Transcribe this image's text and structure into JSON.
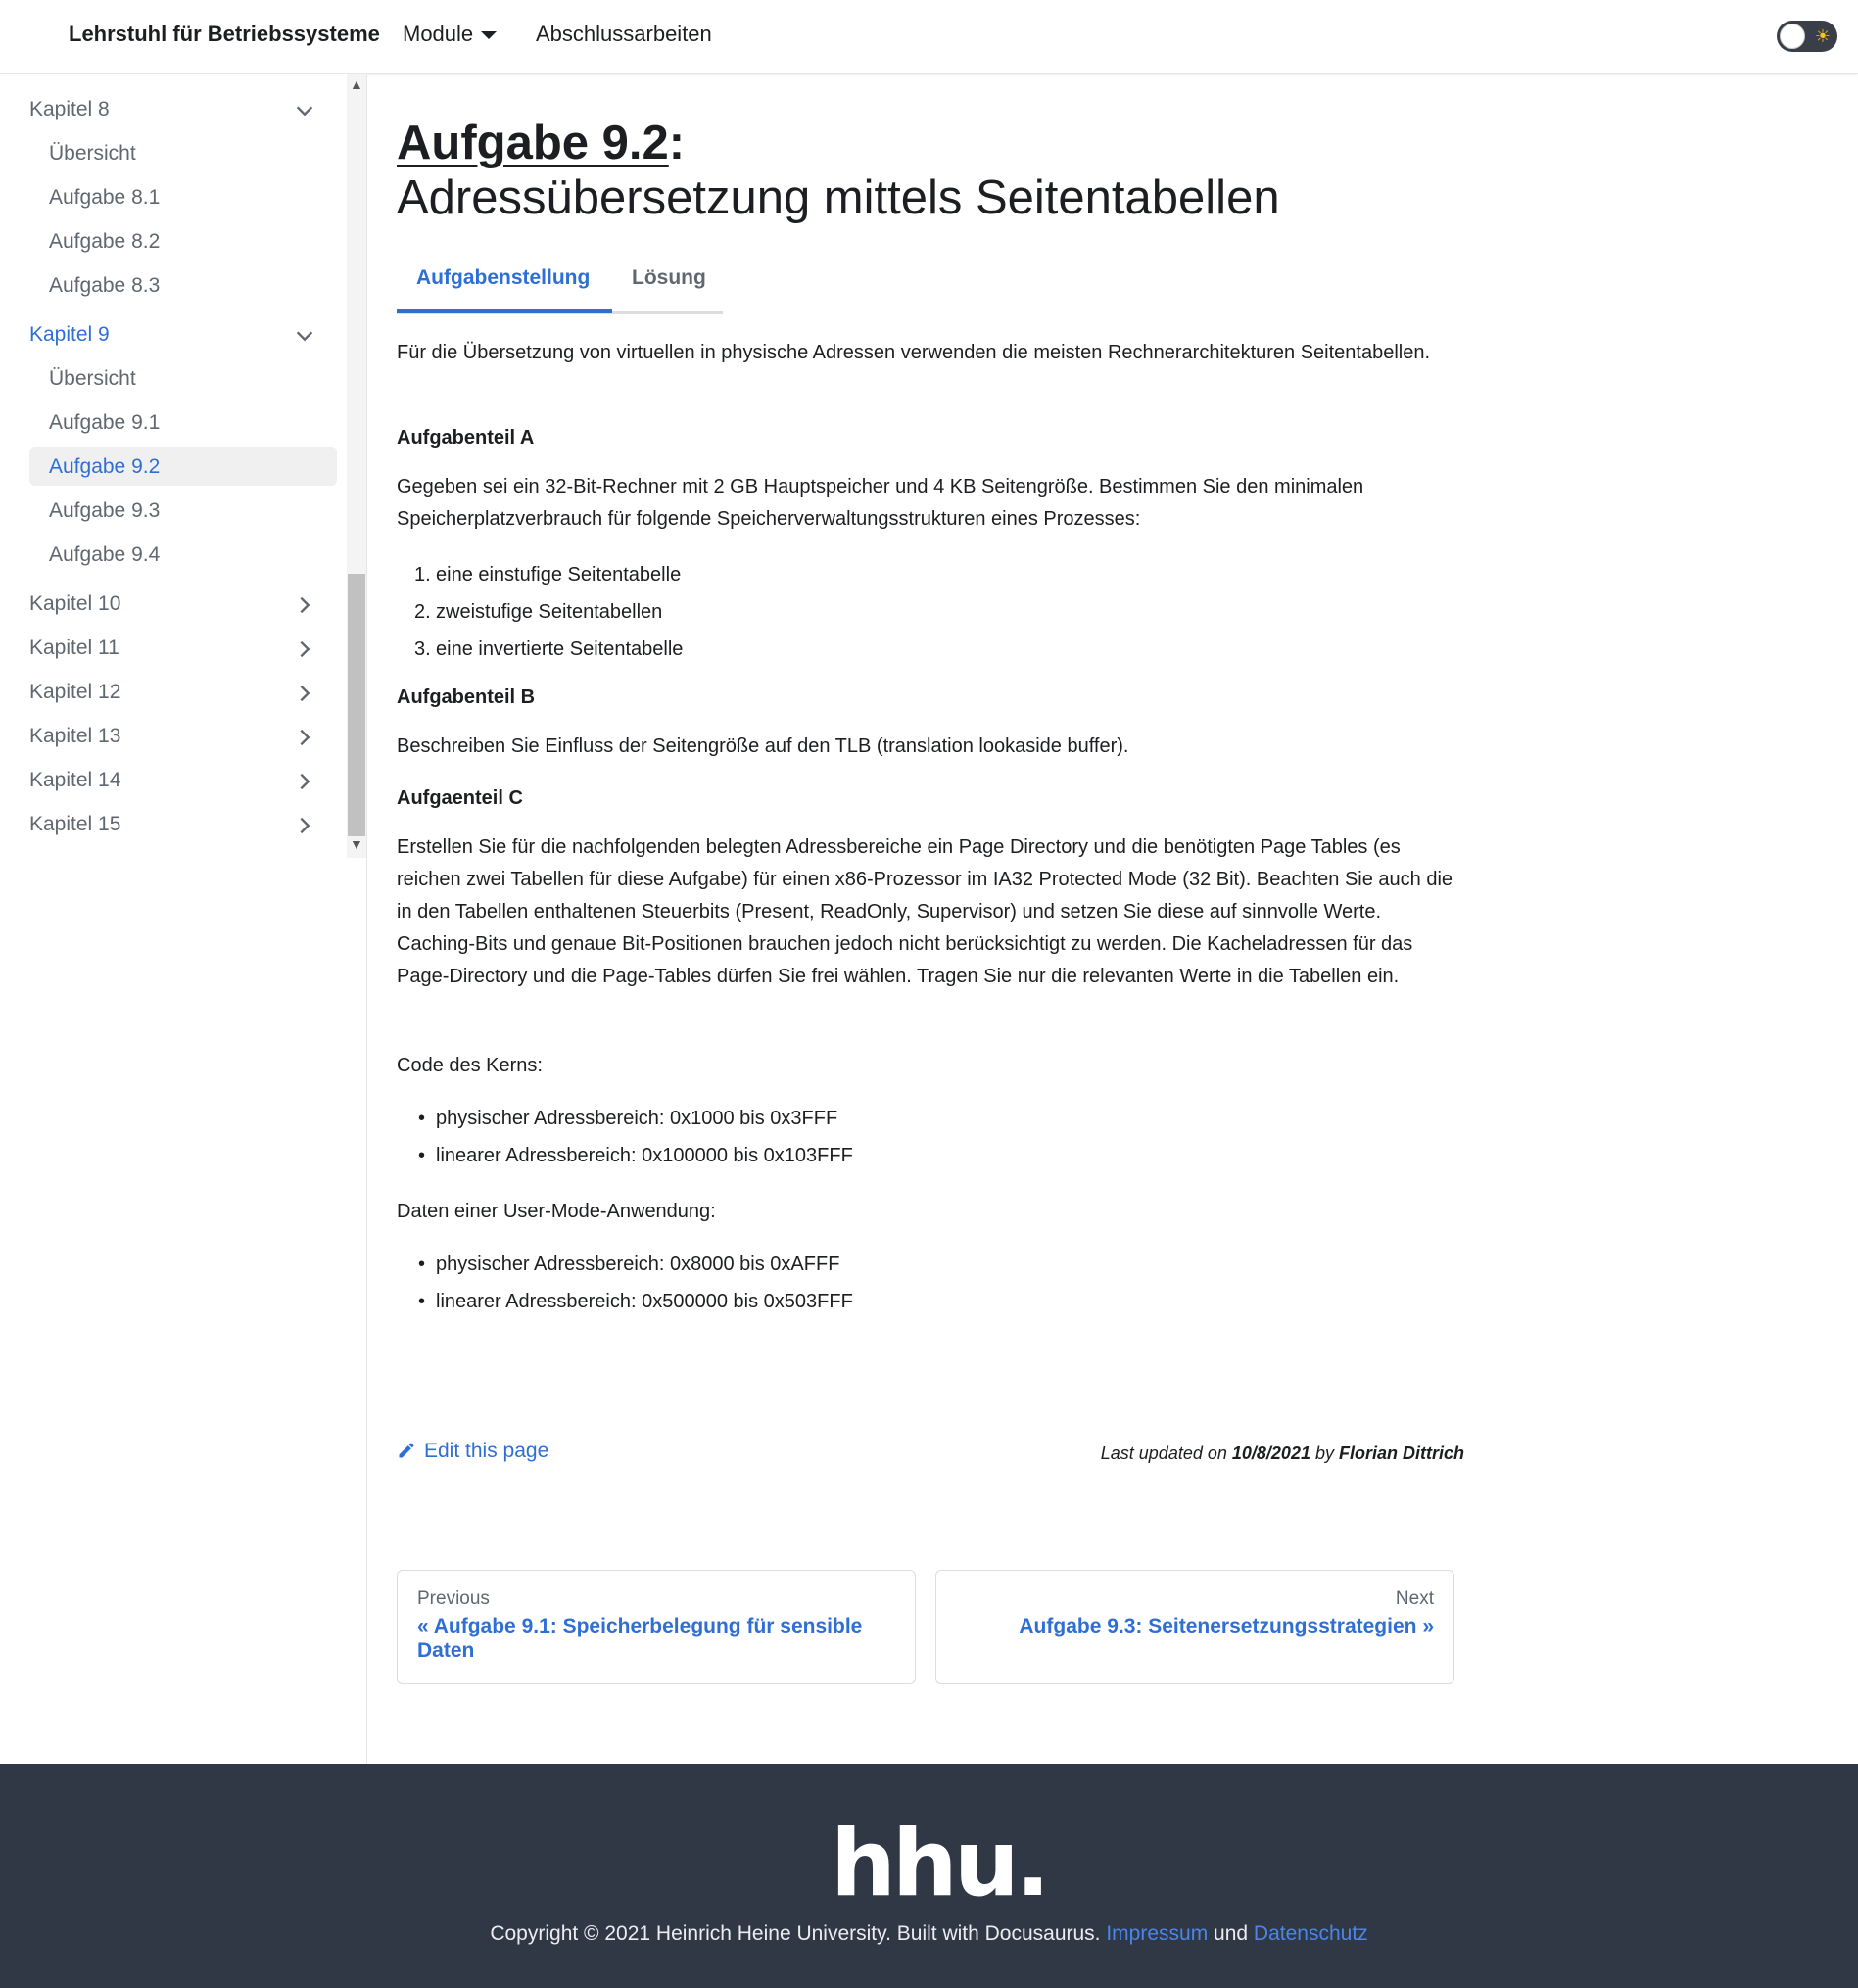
{
  "navbar": {
    "brand": "Lehrstuhl für Betriebssysteme",
    "items": [
      {
        "label": "Module"
      },
      {
        "label": "Abschlussarbeiten"
      }
    ],
    "toggle_icon": "sun-icon"
  },
  "sidebar": {
    "items": [
      {
        "label": "Kapitel 8",
        "type": "category",
        "expanded": true
      },
      {
        "label": "Übersicht",
        "type": "link"
      },
      {
        "label": "Aufgabe 8.1",
        "type": "link"
      },
      {
        "label": "Aufgabe 8.2",
        "type": "link"
      },
      {
        "label": "Aufgabe 8.3",
        "type": "link"
      },
      {
        "label": "Kapitel 9",
        "type": "category",
        "expanded": true,
        "active": true
      },
      {
        "label": "Übersicht",
        "type": "link"
      },
      {
        "label": "Aufgabe 9.1",
        "type": "link"
      },
      {
        "label": "Aufgabe 9.2",
        "type": "link",
        "active": true
      },
      {
        "label": "Aufgabe 9.3",
        "type": "link"
      },
      {
        "label": "Aufgabe 9.4",
        "type": "link"
      },
      {
        "label": "Kapitel 10",
        "type": "category",
        "expanded": false
      },
      {
        "label": "Kapitel 11",
        "type": "category",
        "expanded": false
      },
      {
        "label": "Kapitel 12",
        "type": "category",
        "expanded": false
      },
      {
        "label": "Kapitel 13",
        "type": "category",
        "expanded": false
      },
      {
        "label": "Kapitel 14",
        "type": "category",
        "expanded": false
      },
      {
        "label": "Kapitel 15",
        "type": "category",
        "expanded": false
      }
    ]
  },
  "main": {
    "title_link": "Aufgabe 9.2",
    "title_colon": ":",
    "subtitle": "Adressübersetzung mittels Seitentabellen",
    "tabs": [
      {
        "label": "Aufgabenstellung",
        "active": true
      },
      {
        "label": "Lösung",
        "active": false
      }
    ],
    "intro": "Für die Übersetzung von virtuellen in physische Adressen verwenden die meisten Rechnerarchitekturen Seitentabellen.",
    "part_a": {
      "heading": "Aufgabenteil A",
      "text": "Gegeben sei ein 32-Bit-Rechner mit 2 GB Hauptspeicher und 4 KB Seitengröße. Bestimmen Sie den minimalen Speicherplatzverbrauch für folgende Speicherverwaltungsstrukturen eines Prozesses:",
      "list": [
        "eine einstufige Seitentabelle",
        "zweistufige Seitentabellen",
        "eine invertierte Seitentabelle"
      ],
      "numbers": [
        "1.",
        "2.",
        "3."
      ]
    },
    "part_b": {
      "heading": "Aufgabenteil B",
      "text": "Beschreiben Sie Einfluss der Seitengröße auf den TLB (translation lookaside buffer)."
    },
    "part_c": {
      "heading": "Aufgaenteil C",
      "text": "Erstellen Sie für die nachfolgenden belegten Adressbereiche ein Page Directory und die benötigten Page Tables (es reichen zwei Tabellen für diese Aufgabe) für einen x86-Prozessor im IA32 Protected Mode (32 Bit). Beachten Sie auch die in den Tabellen enthaltenen Steuerbits (Present, ReadOnly, Supervisor) und setzen Sie diese auf sinnvolle Werte. Caching-Bits und genaue Bit-Positionen brauchen jedoch nicht berücksichtigt zu werden. Die Kacheladressen für das Page-Directory und die Page-Tables dürfen Sie frei wählen. Tragen Sie nur die relevanten Werte in die Tabellen ein.",
      "kernel_label": "Code des Kerns:",
      "kernel_list": [
        "physischer Adressbereich: 0x1000 bis 0x3FFF",
        "linearer Adressbereich: 0x100000 bis 0x103FFF"
      ],
      "user_label": "Daten einer User-Mode-Anwendung:",
      "user_list": [
        "physischer Adressbereich: 0x8000 bis 0xAFFF",
        "linearer Adressbereich: 0x500000 bis 0x503FFF"
      ]
    },
    "edit_label": "Edit this page",
    "updated": {
      "prefix": "Last updated on ",
      "date": "10/8/2021",
      "by": " by ",
      "author": "Florian Dittrich"
    },
    "pager": {
      "prev_sub": "Previous",
      "prev_label": "« Aufgabe 9.1: Speicherbelegung für sensible Daten",
      "next_sub": "Next",
      "next_label": "Aufgabe 9.3: Seitenersetzungsstrategien »"
    }
  },
  "footer": {
    "logo": "hhu.",
    "copyright": "Copyright © 2021 Heinrich Heine University. Built with Docusaurus. ",
    "impressum": "Impressum",
    "und": " und ",
    "datenschutz": "Datenschutz",
    "bg_color": "#303846"
  },
  "colors": {
    "accent": "#2e6fd6",
    "text": "#1c1e21",
    "muted": "#606770"
  }
}
